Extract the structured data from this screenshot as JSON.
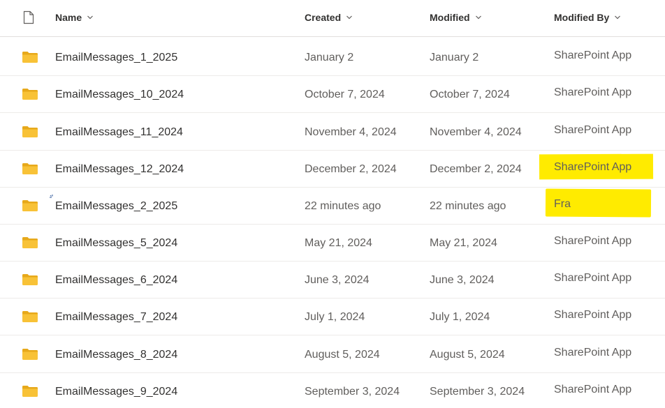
{
  "colors": {
    "folder": "#f8c237",
    "folder_back": "#e7a91b",
    "highlight": "#ffeb00",
    "header_text": "#323130",
    "secondary_text": "#605e5c"
  },
  "header": {
    "file_type_icon": "file-icon",
    "name": "Name",
    "created": "Created",
    "modified": "Modified",
    "modified_by": "Modified By"
  },
  "rows": [
    {
      "name": "EmailMessages_1_2025",
      "created": "January 2",
      "modified": "January 2",
      "modified_by": "SharePoint App"
    },
    {
      "name": "EmailMessages_10_2024",
      "created": "October 7, 2024",
      "modified": "October 7, 2024",
      "modified_by": "SharePoint App"
    },
    {
      "name": "EmailMessages_11_2024",
      "created": "November 4, 2024",
      "modified": "November 4, 2024",
      "modified_by": "SharePoint App"
    },
    {
      "name": "EmailMessages_12_2024",
      "created": "December 2, 2024",
      "modified": "December 2, 2024",
      "modified_by": "SharePoint App"
    },
    {
      "name": "EmailMessages_2_2025",
      "created": "22 minutes ago",
      "modified": "22 minutes ago",
      "modified_by": "Fra"
    },
    {
      "name": "EmailMessages_5_2024",
      "created": "May 21, 2024",
      "modified": "May 21, 2024",
      "modified_by": "SharePoint App"
    },
    {
      "name": "EmailMessages_6_2024",
      "created": "June 3, 2024",
      "modified": "June 3, 2024",
      "modified_by": "SharePoint App"
    },
    {
      "name": "EmailMessages_7_2024",
      "created": "July 1, 2024",
      "modified": "July 1, 2024",
      "modified_by": "SharePoint App"
    },
    {
      "name": "EmailMessages_8_2024",
      "created": "August 5, 2024",
      "modified": "August 5, 2024",
      "modified_by": "SharePoint App"
    },
    {
      "name": "EmailMessages_9_2024",
      "created": "September 3, 2024",
      "modified": "September 3, 2024",
      "modified_by": "SharePoint App"
    }
  ]
}
